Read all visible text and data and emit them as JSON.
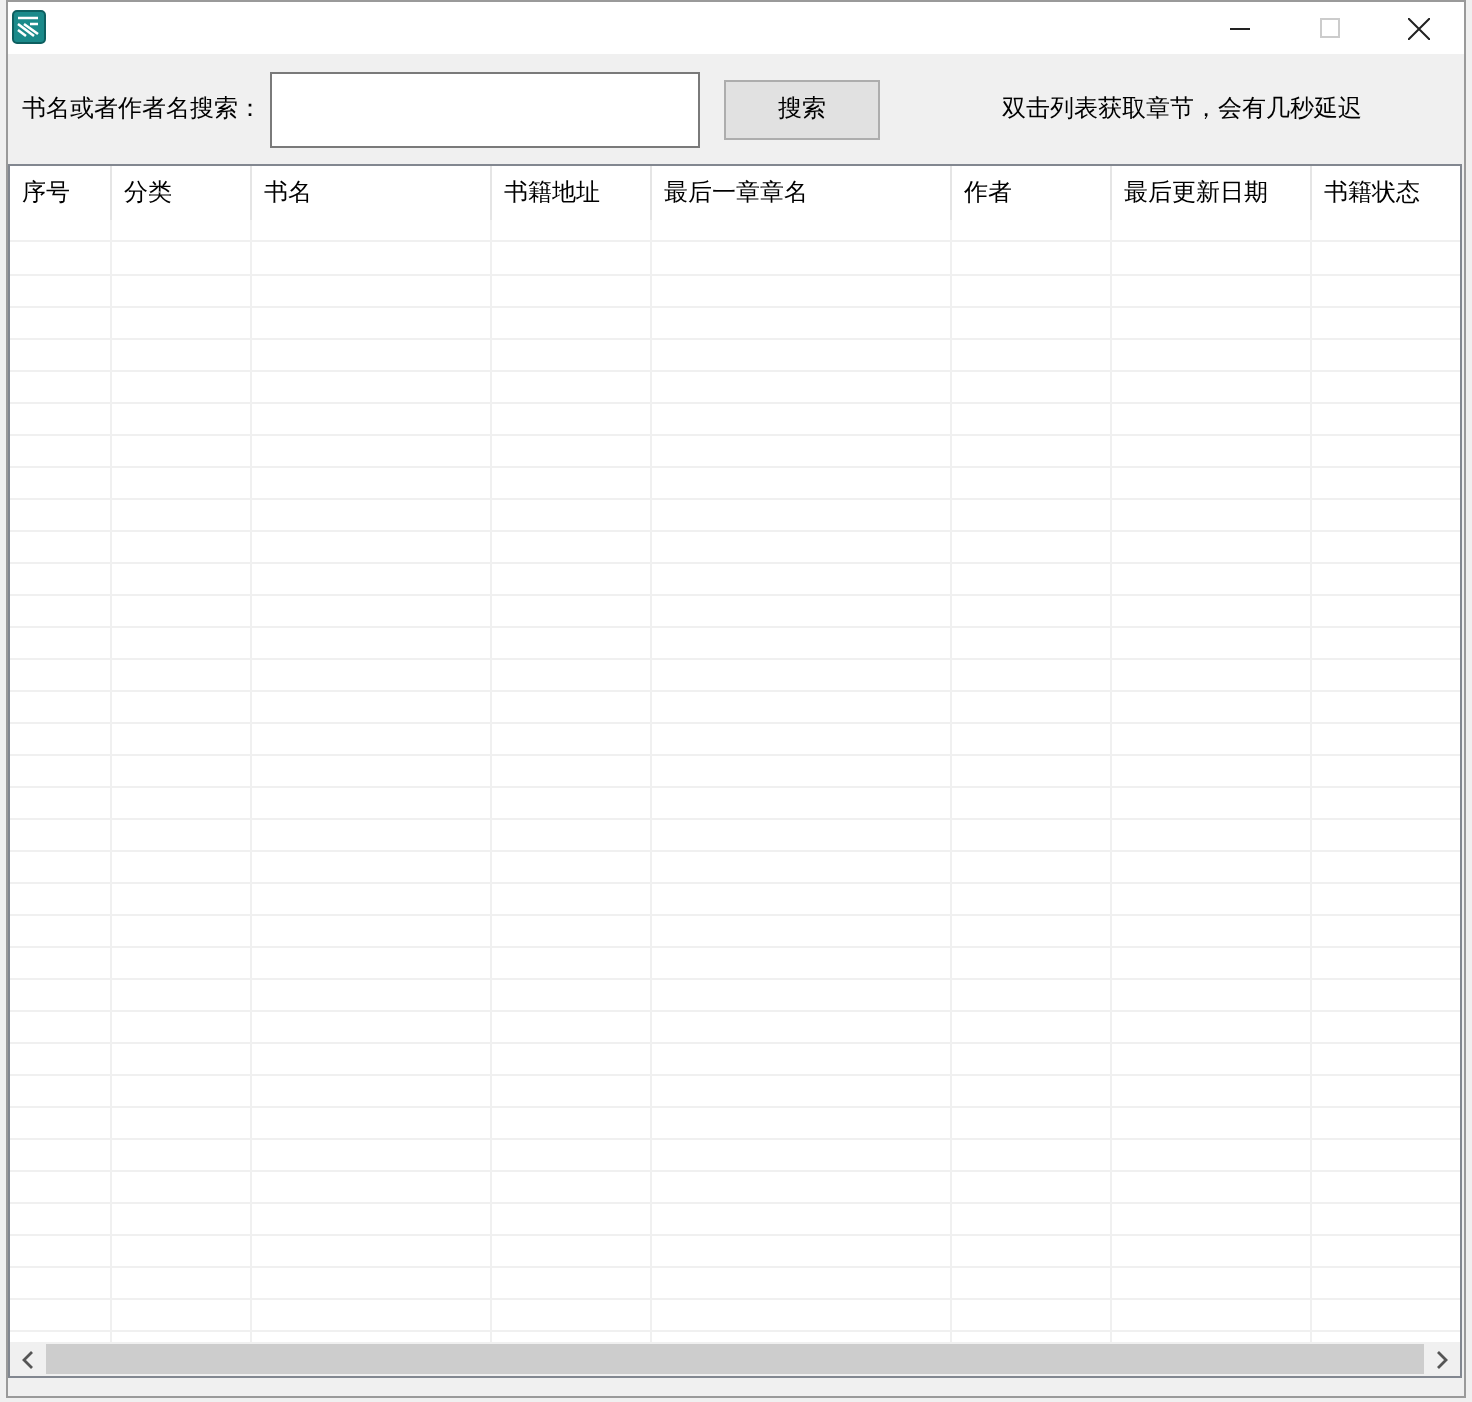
{
  "window": {
    "controls": [
      {
        "kind": "minimize",
        "disabled": false
      },
      {
        "kind": "maximize",
        "disabled": true
      },
      {
        "kind": "close",
        "disabled": false
      }
    ]
  },
  "search": {
    "label": "书名或者作者名搜索：",
    "button": "搜索",
    "hint": "双击列表获取章节，会有几秒延迟"
  },
  "table": {
    "columns": [
      "序号",
      "分类",
      "书名",
      "书籍地址",
      "最后一章章名",
      "作者",
      "最后更新日期",
      "书籍状态"
    ]
  }
}
